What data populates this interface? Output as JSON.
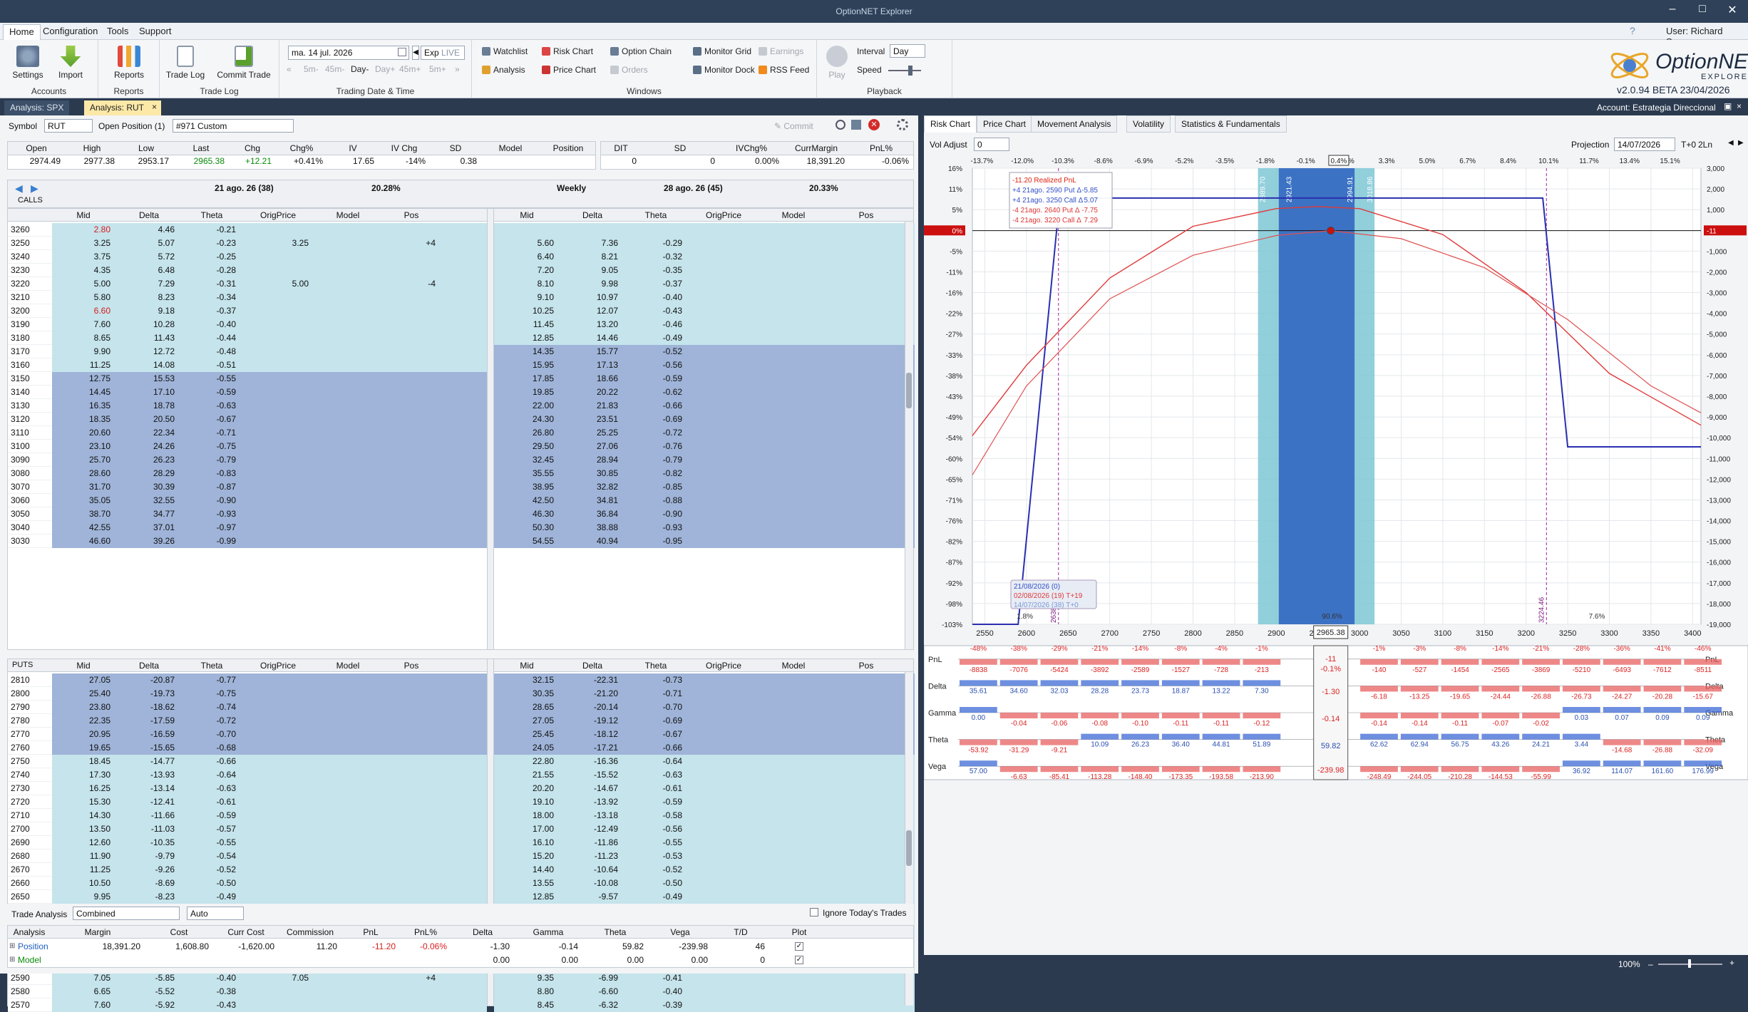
{
  "app": {
    "title": "OptionNET Explorer",
    "user": "User: Richard Saenz",
    "version": "v2.0.94 BETA 23/04/2026",
    "account": "Account: Estrategia Direccional",
    "logo_main": "OptionNET",
    "logo_sub": "EXPLORER"
  },
  "menu": [
    "Home",
    "Configuration",
    "Tools",
    "Support"
  ],
  "ribbon": {
    "accounts": {
      "label": "Accounts",
      "settings": "Settings",
      "import": "Import"
    },
    "reports": {
      "label": "Reports",
      "reports": "Reports"
    },
    "tradelog": {
      "label": "Trade Log",
      "trade_log": "Trade Log",
      "commit_trade": "Commit Trade"
    },
    "tradingdate": {
      "label": "Trading Date & Time",
      "date": "ma. 14 jul. 2026",
      "exp": "Exp",
      "live": "LIVE",
      "steps": [
        "5m-",
        "45m-",
        "Day-",
        "Day+",
        "45m+",
        "5m+"
      ]
    },
    "windows": {
      "label": "Windows",
      "items": [
        "Watchlist",
        "Risk Chart",
        "Option Chain",
        "Monitor Grid",
        "Earnings",
        "Analysis",
        "Price Chart",
        "Orders",
        "Monitor Dock",
        "RSS Feed"
      ]
    },
    "playback": {
      "label": "Playback",
      "play": "Play",
      "interval_label": "Interval",
      "interval": "Day",
      "speed_label": "Speed"
    }
  },
  "doctabs": [
    "Analysis: SPX",
    "Analysis: RUT"
  ],
  "symbolbar": {
    "symbol_label": "Symbol",
    "symbol": "RUT",
    "open_pos_label": "Open Position (1)",
    "position": "#971 Custom",
    "commit": "Commit"
  },
  "quote": {
    "headers": [
      "Open",
      "High",
      "Low",
      "Last",
      "Chg",
      "Chg%",
      "IV",
      "IV Chg",
      "SD",
      "Model",
      "Position"
    ],
    "values": [
      "2974.49",
      "2977.38",
      "2953.17",
      "2965.38",
      "+12.21",
      "+0.41%",
      "17.65",
      "-14%",
      "0.38",
      "",
      ""
    ]
  },
  "quote2": {
    "headers": [
      "DIT",
      "SD",
      "IVChg%",
      "CurrMargin",
      "PnL%"
    ],
    "values": [
      "0",
      "0",
      "0.00%",
      "18,391.20",
      "-0.06%"
    ]
  },
  "chain": {
    "exp1": "21 ago. 26 (38)",
    "iv1": "20.28%",
    "weekly": "Weekly",
    "exp2": "28 ago. 26 (45)",
    "iv2": "20.33%",
    "calls_label": "CALLS",
    "puts_label": "PUTS",
    "cols": [
      "Mid",
      "Delta",
      "Theta",
      "OrigPrice",
      "Model",
      "Pos"
    ],
    "calls": [
      [
        "3260",
        "2.80",
        "4.46",
        "-0.21",
        "",
        "",
        "",
        "",
        "",
        "",
        "",
        "",
        ""
      ],
      [
        "3250",
        "3.25",
        "5.07",
        "-0.23",
        "3.25",
        "",
        "+4",
        "5.60",
        "7.36",
        "-0.29",
        "",
        "",
        ""
      ],
      [
        "3240",
        "3.75",
        "5.72",
        "-0.25",
        "",
        "",
        "",
        "6.40",
        "8.21",
        "-0.32",
        "",
        "",
        ""
      ],
      [
        "3230",
        "4.35",
        "6.48",
        "-0.28",
        "",
        "",
        "",
        "7.20",
        "9.05",
        "-0.35",
        "",
        "",
        ""
      ],
      [
        "3220",
        "5.00",
        "7.29",
        "-0.31",
        "5.00",
        "",
        "-4",
        "8.10",
        "9.98",
        "-0.37",
        "",
        "",
        ""
      ],
      [
        "3210",
        "5.80",
        "8.23",
        "-0.34",
        "",
        "",
        "",
        "9.10",
        "10.97",
        "-0.40",
        "",
        "",
        ""
      ],
      [
        "3200",
        "6.60",
        "9.18",
        "-0.37",
        "",
        "",
        "",
        "10.25",
        "12.07",
        "-0.43",
        "",
        "",
        ""
      ],
      [
        "3190",
        "7.60",
        "10.28",
        "-0.40",
        "",
        "",
        "",
        "11.45",
        "13.20",
        "-0.46",
        "",
        "",
        ""
      ],
      [
        "3180",
        "8.65",
        "11.43",
        "-0.44",
        "",
        "",
        "",
        "12.85",
        "14.46",
        "-0.49",
        "",
        "",
        ""
      ],
      [
        "3170",
        "9.90",
        "12.72",
        "-0.48",
        "",
        "",
        "",
        "14.35",
        "15.77",
        "-0.52",
        "",
        "",
        ""
      ],
      [
        "3160",
        "11.25",
        "14.08",
        "-0.51",
        "",
        "",
        "",
        "15.95",
        "17.13",
        "-0.56",
        "",
        "",
        ""
      ],
      [
        "3150",
        "12.75",
        "15.53",
        "-0.55",
        "",
        "",
        "",
        "17.85",
        "18.66",
        "-0.59",
        "",
        "",
        ""
      ],
      [
        "3140",
        "14.45",
        "17.10",
        "-0.59",
        "",
        "",
        "",
        "19.85",
        "20.22",
        "-0.62",
        "",
        "",
        ""
      ],
      [
        "3130",
        "16.35",
        "18.78",
        "-0.63",
        "",
        "",
        "",
        "22.00",
        "21.83",
        "-0.66",
        "",
        "",
        ""
      ],
      [
        "3120",
        "18.35",
        "20.50",
        "-0.67",
        "",
        "",
        "",
        "24.30",
        "23.51",
        "-0.69",
        "",
        "",
        ""
      ],
      [
        "3110",
        "20.60",
        "22.34",
        "-0.71",
        "",
        "",
        "",
        "26.80",
        "25.25",
        "-0.72",
        "",
        "",
        ""
      ],
      [
        "3100",
        "23.10",
        "24.26",
        "-0.75",
        "",
        "",
        "",
        "29.50",
        "27.06",
        "-0.76",
        "",
        "",
        ""
      ],
      [
        "3090",
        "25.70",
        "26.23",
        "-0.79",
        "",
        "",
        "",
        "32.45",
        "28.94",
        "-0.79",
        "",
        "",
        ""
      ],
      [
        "3080",
        "28.60",
        "28.29",
        "-0.83",
        "",
        "",
        "",
        "35.55",
        "30.85",
        "-0.82",
        "",
        "",
        ""
      ],
      [
        "3070",
        "31.70",
        "30.39",
        "-0.87",
        "",
        "",
        "",
        "38.95",
        "32.82",
        "-0.85",
        "",
        "",
        ""
      ],
      [
        "3060",
        "35.05",
        "32.55",
        "-0.90",
        "",
        "",
        "",
        "42.50",
        "34.81",
        "-0.88",
        "",
        "",
        ""
      ],
      [
        "3050",
        "38.70",
        "34.77",
        "-0.93",
        "",
        "",
        "",
        "46.30",
        "36.84",
        "-0.90",
        "",
        "",
        ""
      ],
      [
        "3040",
        "42.55",
        "37.01",
        "-0.97",
        "",
        "",
        "",
        "50.30",
        "38.88",
        "-0.93",
        "",
        "",
        ""
      ],
      [
        "3030",
        "46.60",
        "39.26",
        "-0.99",
        "",
        "",
        "",
        "54.55",
        "40.94",
        "-0.95",
        "",
        "",
        ""
      ]
    ],
    "puts": [
      [
        "2810",
        "27.05",
        "-20.87",
        "-0.77",
        "",
        "",
        "",
        "32.15",
        "-22.31",
        "-0.73",
        "",
        "",
        ""
      ],
      [
        "2800",
        "25.40",
        "-19.73",
        "-0.75",
        "",
        "",
        "",
        "30.35",
        "-21.20",
        "-0.71",
        "",
        "",
        ""
      ],
      [
        "2790",
        "23.80",
        "-18.62",
        "-0.74",
        "",
        "",
        "",
        "28.65",
        "-20.14",
        "-0.70",
        "",
        "",
        ""
      ],
      [
        "2780",
        "22.35",
        "-17.59",
        "-0.72",
        "",
        "",
        "",
        "27.05",
        "-19.12",
        "-0.69",
        "",
        "",
        ""
      ],
      [
        "2770",
        "20.95",
        "-16.59",
        "-0.70",
        "",
        "",
        "",
        "25.45",
        "-18.12",
        "-0.67",
        "",
        "",
        ""
      ],
      [
        "2760",
        "19.65",
        "-15.65",
        "-0.68",
        "",
        "",
        "",
        "24.05",
        "-17.21",
        "-0.66",
        "",
        "",
        ""
      ],
      [
        "2750",
        "18.45",
        "-14.77",
        "-0.66",
        "",
        "",
        "",
        "22.80",
        "-16.36",
        "-0.64",
        "",
        "",
        ""
      ],
      [
        "2740",
        "17.30",
        "-13.93",
        "-0.64",
        "",
        "",
        "",
        "21.55",
        "-15.52",
        "-0.63",
        "",
        "",
        ""
      ],
      [
        "2730",
        "16.25",
        "-13.14",
        "-0.63",
        "",
        "",
        "",
        "20.20",
        "-14.67",
        "-0.61",
        "",
        "",
        ""
      ],
      [
        "2720",
        "15.30",
        "-12.41",
        "-0.61",
        "",
        "",
        "",
        "19.10",
        "-13.92",
        "-0.59",
        "",
        "",
        ""
      ],
      [
        "2710",
        "14.30",
        "-11.66",
        "-0.59",
        "",
        "",
        "",
        "18.00",
        "-13.18",
        "-0.58",
        "",
        "",
        ""
      ],
      [
        "2700",
        "13.50",
        "-11.03",
        "-0.57",
        "",
        "",
        "",
        "17.00",
        "-12.49",
        "-0.56",
        "",
        "",
        ""
      ],
      [
        "2690",
        "12.60",
        "-10.35",
        "-0.55",
        "",
        "",
        "",
        "16.10",
        "-11.86",
        "-0.55",
        "",
        "",
        ""
      ],
      [
        "2680",
        "11.90",
        "-9.79",
        "-0.54",
        "",
        "",
        "",
        "15.20",
        "-11.23",
        "-0.53",
        "",
        "",
        ""
      ],
      [
        "2670",
        "11.25",
        "-9.26",
        "-0.52",
        "",
        "",
        "",
        "14.40",
        "-10.64",
        "-0.52",
        "",
        "",
        ""
      ],
      [
        "2660",
        "10.50",
        "-8.69",
        "-0.50",
        "",
        "",
        "",
        "13.55",
        "-10.08",
        "-0.50",
        "",
        "",
        ""
      ],
      [
        "2650",
        "9.95",
        "-8.23",
        "-0.49",
        "",
        "",
        "",
        "12.85",
        "-9.57",
        "-0.49",
        "",
        "",
        ""
      ],
      [
        "2640",
        "9.35",
        "-7.75",
        "-0.47",
        "9.35",
        "",
        "-4",
        "12.15",
        "-9.07",
        "-0.48",
        "",
        "",
        ""
      ],
      [
        "2630",
        "8.85",
        "-7.34",
        "-0.46",
        "",
        "",
        "",
        "11.55",
        "-8.61",
        "-0.46",
        "",
        "",
        ""
      ],
      [
        "2620",
        "8.35",
        "-6.94",
        "-0.44",
        "",
        "",
        "",
        "10.90",
        "-8.16",
        "-0.45",
        "",
        "",
        ""
      ],
      [
        "2610",
        "7.85",
        "-6.53",
        "-0.42",
        "",
        "",
        "",
        "10.40",
        "-7.77",
        "-0.44",
        "",
        "",
        ""
      ],
      [
        "2600",
        "7.45",
        "-6.19",
        "-0.41",
        "",
        "",
        "",
        "9.85",
        "-7.36",
        "-0.42",
        "",
        "",
        ""
      ],
      [
        "2590",
        "7.05",
        "-5.85",
        "-0.40",
        "7.05",
        "",
        "+4",
        "9.35",
        "-6.99",
        "-0.41",
        "",
        "",
        ""
      ],
      [
        "2580",
        "6.65",
        "-5.52",
        "-0.38",
        "",
        "",
        "",
        "8.80",
        "-6.60",
        "-0.40",
        "",
        "",
        ""
      ],
      [
        "2570",
        "7.60",
        "-5.92",
        "-0.43",
        "",
        "",
        "",
        "8.45",
        "-6.32",
        "-0.39",
        "",
        "",
        ""
      ]
    ]
  },
  "trade_analysis": {
    "label": "Trade Analysis",
    "mode": "Combined",
    "auto": "Auto",
    "ignore": "Ignore Today's Trades",
    "headers": [
      "Analysis",
      "Margin",
      "Cost",
      "Curr Cost",
      "Commission",
      "PnL",
      "PnL%",
      "Delta",
      "Gamma",
      "Theta",
      "Vega",
      "T/D",
      "Plot"
    ],
    "rows": [
      [
        "Position",
        "18,391.20",
        "1,608.80",
        "-1,620.00",
        "11.20",
        "-11.20",
        "-0.06%",
        "-1.30",
        "-0.14",
        "59.82",
        "-239.98",
        "46",
        ""
      ],
      [
        "Model",
        "",
        "",
        "",
        "",
        "",
        "",
        "0.00",
        "0.00",
        "0.00",
        "0.00",
        "0",
        ""
      ]
    ]
  },
  "right": {
    "tabs": [
      "Risk Chart",
      "Price Chart",
      "Movement Analysis",
      "Volatility",
      "Statistics & Fundamentals"
    ],
    "vol_adjust_label": "Vol Adjust",
    "vol_adjust": "0",
    "projection_label": "Projection",
    "projection": "14/07/2026",
    "tplus": "T+0",
    "lines": "2Ln",
    "status_zoom": "100%"
  },
  "chart_data": {
    "type": "line",
    "title": "",
    "x_ticks": [
      "2550",
      "2600",
      "2650",
      "2700",
      "2750",
      "2800",
      "2850",
      "2900",
      "2950",
      "3000",
      "3050",
      "3100",
      "3150",
      "3200",
      "3250",
      "3300",
      "3350",
      "3400"
    ],
    "top_pct_ticks": [
      "-13.7%",
      "-12.0%",
      "-10.3%",
      "-8.6%",
      "-6.9%",
      "-5.2%",
      "-3.5%",
      "-1.8%",
      "-0.1%",
      "1.6%",
      "3.3%",
      "5.0%",
      "6.7%",
      "8.4%",
      "10.1%",
      "11.7%",
      "13.4%",
      "15.1%"
    ],
    "top_pct_highlight": "0.4%",
    "left_ticks": [
      "16%",
      "11%",
      "5%",
      "0%",
      "-5%",
      "-11%",
      "-16%",
      "-22%",
      "-27%",
      "-33%",
      "-38%",
      "-43%",
      "-49%",
      "-54%",
      "-60%",
      "-65%",
      "-71%",
      "-76%",
      "-82%",
      "-87%",
      "-92%",
      "-98%",
      "-103%"
    ],
    "right_ticks": [
      "3,000",
      "2,000",
      "1,000",
      "-11",
      "-1,000",
      "-2,000",
      "-3,000",
      "-4,000",
      "-5,000",
      "-6,000",
      "-7,000",
      "-8,000",
      "-9,000",
      "-10,000",
      "-11,000",
      "-12,000",
      "-13,000",
      "-14,000",
      "-15,000",
      "-16,000",
      "-17,000",
      "-18,000",
      "-19,000"
    ],
    "xlim": [
      2535,
      3410
    ],
    "ylim": [
      -19000,
      3000
    ],
    "current_price": "2965.38",
    "legend": [
      "-11.20 Realized PnL",
      "+4 21ago. 2590 Put Δ",
      "+4 21ago. 3250 Call Δ",
      "-4 21ago. 2640 Put Δ",
      "-4 21ago. 3220 Call Δ"
    ],
    "legend_vals": [
      "",
      "-5.85",
      "5.07",
      "-7.75",
      "7.29"
    ],
    "date_legend": [
      "21/08/2026 (0)",
      "02/08/2026 (19) T+19",
      "14/07/2026 (38) T+0"
    ],
    "vlines": [
      "2638.40",
      "3224.46"
    ],
    "band_labels": [
      "2889.70",
      "2921.43",
      "2994.91",
      "3018.86"
    ],
    "prob_labels": [
      "1.8%",
      "90.6%",
      "7.6%"
    ],
    "series": [
      {
        "name": "Expiration",
        "x": [
          2535,
          2580,
          2590,
          2640,
          3220,
          3250,
          3260,
          3410
        ],
        "y": [
          -19000,
          -19000,
          -19000,
          1560,
          1560,
          -10440,
          -10440,
          -10440
        ]
      },
      {
        "name": "T+19",
        "x": [
          2535,
          2600,
          2700,
          2800,
          2900,
          2950,
          3000,
          3100,
          3200,
          3300,
          3410
        ],
        "y": [
          -9900,
          -6500,
          -2300,
          200,
          1050,
          1150,
          1050,
          -200,
          -3000,
          -6900,
          -9400
        ]
      },
      {
        "name": "T+0",
        "x": [
          2535,
          2600,
          2700,
          2800,
          2900,
          2965,
          3050,
          3150,
          3250,
          3350,
          3410
        ],
        "y": [
          -11800,
          -7500,
          -3300,
          -1200,
          -250,
          -11,
          -400,
          -1800,
          -4300,
          -7500,
          -8800
        ]
      }
    ],
    "greeks": {
      "rows": [
        "PnL",
        "Delta",
        "Gamma",
        "Theta",
        "Vega"
      ],
      "center": [
        "-11",
        "-0.1%",
        "-1.30",
        "-0.14",
        "59.82",
        "-239.98"
      ],
      "pnl_pct": [
        "-48%",
        "-38%",
        "-29%",
        "-21%",
        "-14%",
        "-8%",
        "-4%",
        "-1%",
        "",
        "-1%",
        "-3%",
        "-8%",
        "-14%",
        "-21%",
        "-28%",
        "-36%",
        "-41%",
        "-46%"
      ],
      "pnl_val": [
        "-8838",
        "-7076",
        "-5424",
        "-3892",
        "-2589",
        "-1527",
        "-728",
        "-213",
        "",
        "-140",
        "-527",
        "-1454",
        "-2565",
        "-3869",
        "-5210",
        "-6493",
        "-7612",
        "-8511"
      ],
      "delta": [
        "35.61",
        "34.60",
        "32.03",
        "28.28",
        "23.73",
        "18.87",
        "13.22",
        "7.30",
        "",
        "-6.18",
        "-13.25",
        "-19.65",
        "-24.44",
        "-26.88",
        "-26.73",
        "-24.27",
        "-20.28",
        "-15.67"
      ],
      "gamma": [
        "0.00",
        "-0.04",
        "-0.06",
        "-0.08",
        "-0.10",
        "-0.11",
        "-0.11",
        "-0.12",
        "",
        "-0.14",
        "-0.14",
        "-0.11",
        "-0.07",
        "-0.02",
        "0.03",
        "0.07",
        "0.09",
        "0.09"
      ],
      "theta": [
        "-53.92",
        "-31.29",
        "-9.21",
        "10.09",
        "26.23",
        "36.40",
        "44.81",
        "51.89",
        "",
        "62.62",
        "62.94",
        "56.75",
        "43.26",
        "24.21",
        "3.44",
        "-14.68",
        "-26.88",
        "-32.09"
      ],
      "vega": [
        "57.00",
        "-6.63",
        "-85.41",
        "-113.28",
        "-148.40",
        "-173.35",
        "-193.58",
        "-213.90",
        "",
        "-248.49",
        "-244.05",
        "-210.28",
        "-144.53",
        "-55.99",
        "36.92",
        "114.07",
        "161.60",
        "176.99"
      ]
    }
  }
}
